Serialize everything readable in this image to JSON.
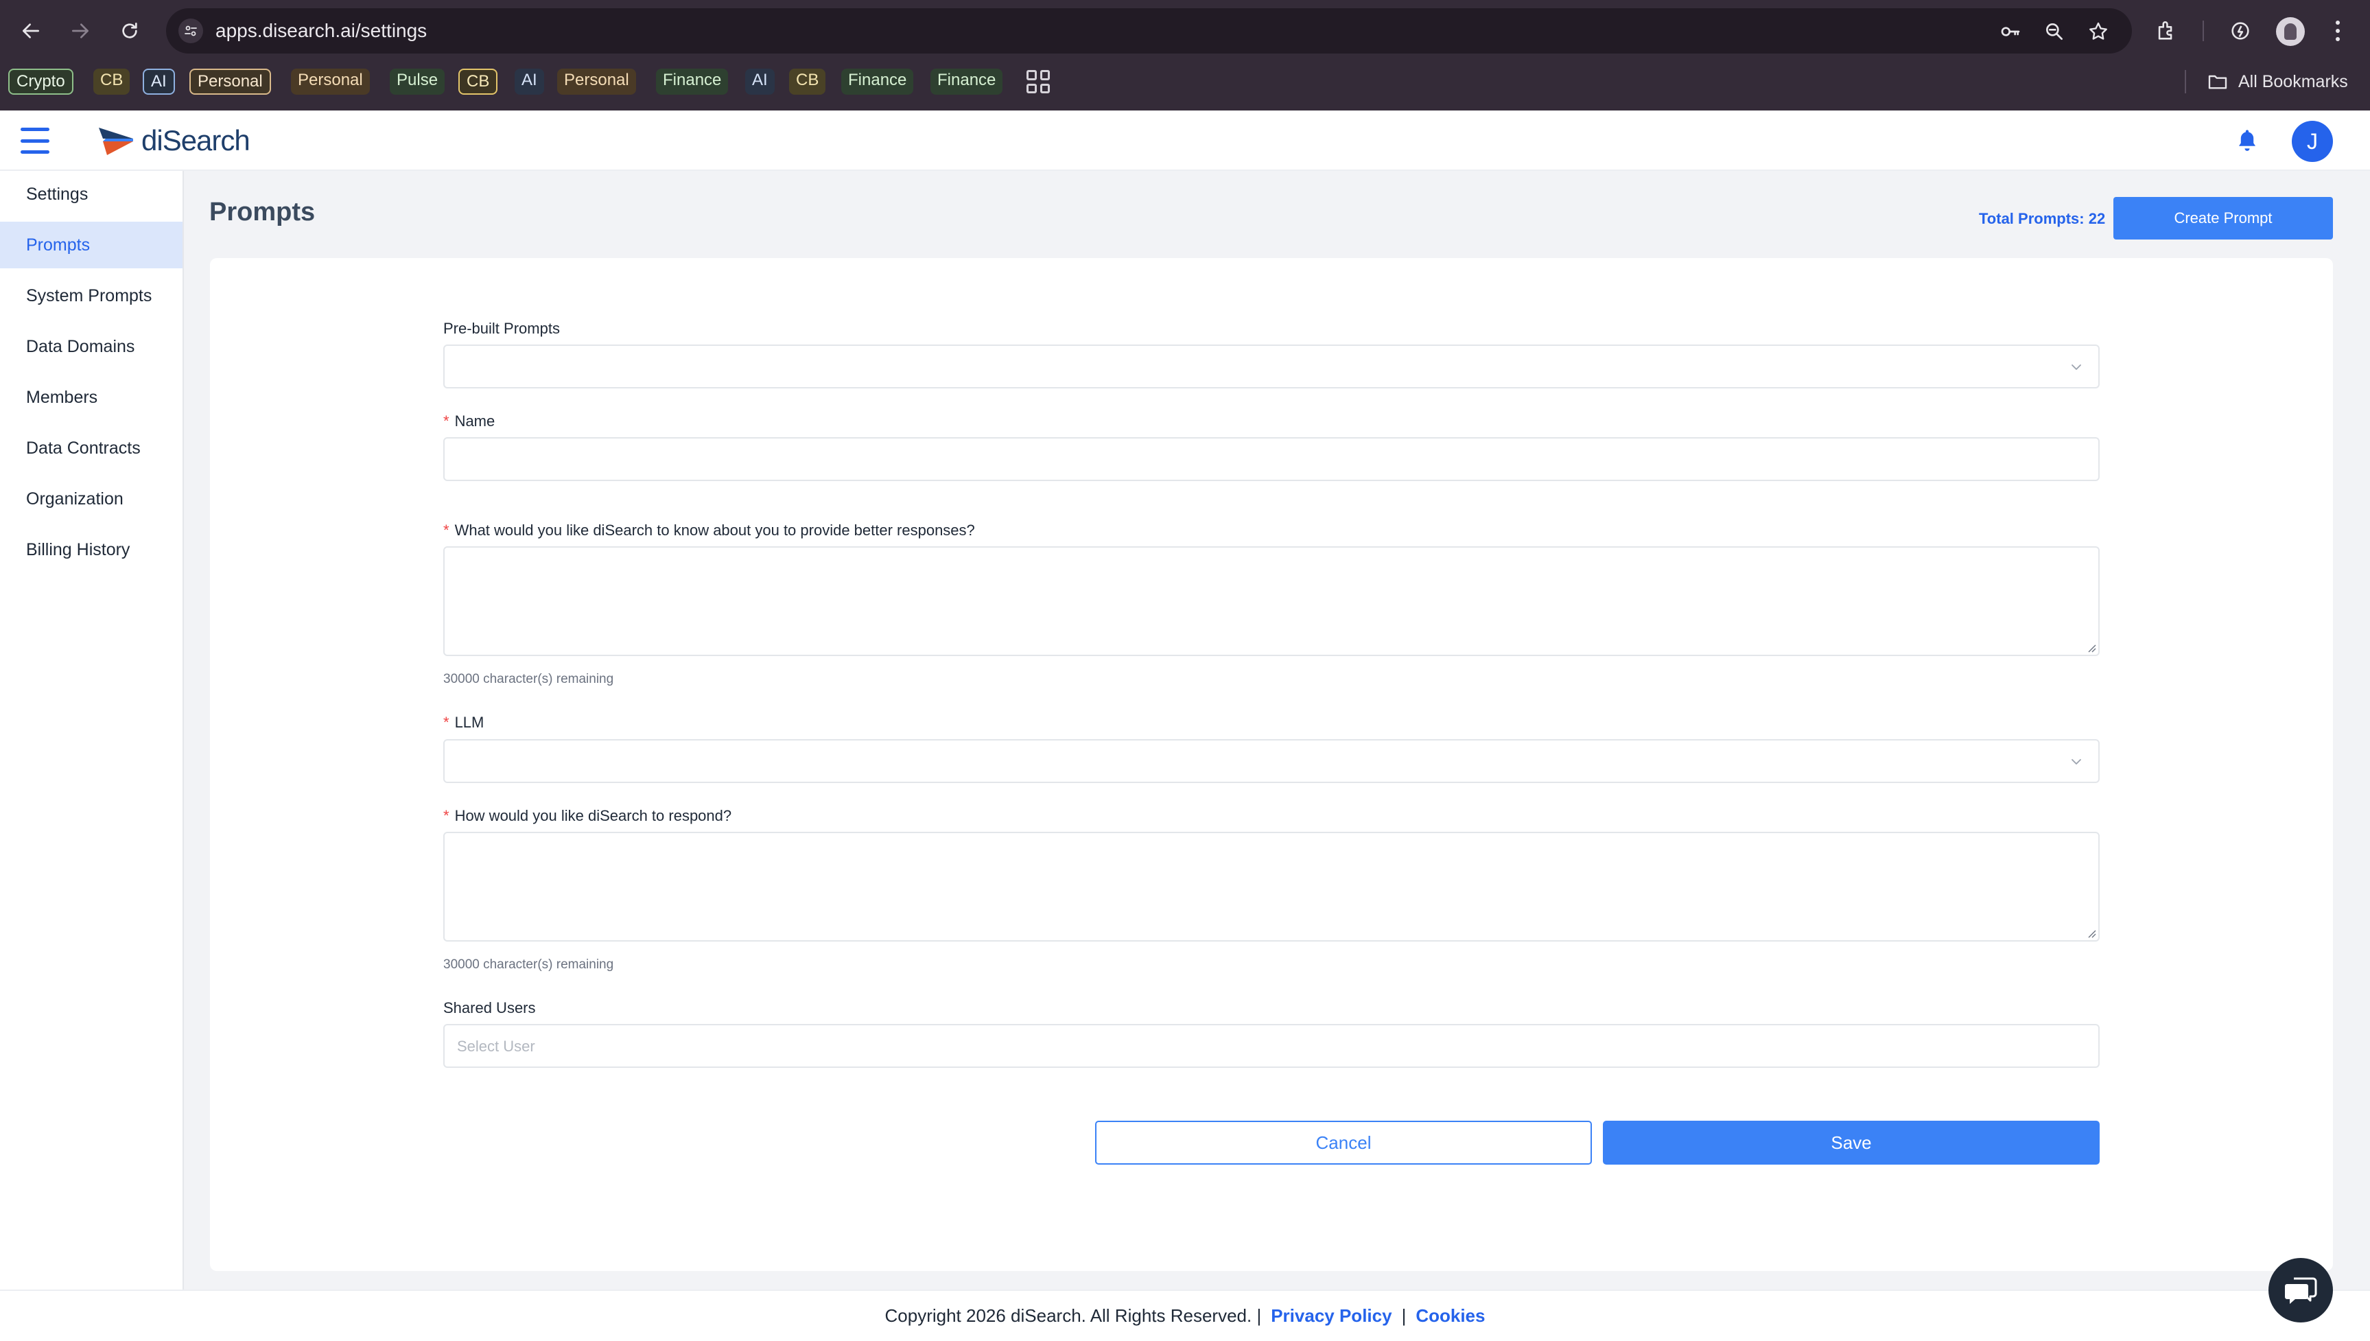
{
  "browser": {
    "url": "apps.disearch.ai/settings",
    "bookmarks": [
      {
        "label": "Crypto",
        "style": "framed-green"
      },
      {
        "label": "CB",
        "style": "fill-yellow"
      },
      {
        "label": "AI",
        "style": "framed-blue"
      },
      {
        "label": "Personal",
        "style": "framed-orange"
      },
      {
        "label": "Personal",
        "style": "fill-orange"
      },
      {
        "label": "Pulse",
        "style": "fill-green"
      },
      {
        "label": "CB",
        "style": "framed-yellow"
      },
      {
        "label": "AI",
        "style": "fill-blue"
      },
      {
        "label": "Personal",
        "style": "fill-orange"
      },
      {
        "label": "Finance",
        "style": "fill-green"
      },
      {
        "label": "AI",
        "style": "fill-blue"
      },
      {
        "label": "CB",
        "style": "fill-yellow"
      },
      {
        "label": "Finance",
        "style": "fill-green"
      },
      {
        "label": "Finance",
        "style": "fill-green"
      }
    ],
    "all_bookmarks": "All Bookmarks"
  },
  "app": {
    "brand": "diSearch",
    "avatar_initial": "J",
    "accent_color": "#3b82f6"
  },
  "sidebar": {
    "items": [
      {
        "label": "Settings",
        "active": false
      },
      {
        "label": "Prompts",
        "active": true
      },
      {
        "label": "System Prompts",
        "active": false
      },
      {
        "label": "Data Domains",
        "active": false
      },
      {
        "label": "Members",
        "active": false
      },
      {
        "label": "Data Contracts",
        "active": false
      },
      {
        "label": "Organization",
        "active": false
      },
      {
        "label": "Billing History",
        "active": false
      }
    ]
  },
  "main": {
    "title": "Prompts",
    "total_prompts": "Total Prompts: 22",
    "create_button": "Create Prompt"
  },
  "form": {
    "prebuilt": {
      "label": "Pre-built Prompts",
      "value": ""
    },
    "name": {
      "label": "Name",
      "value": ""
    },
    "about": {
      "label": "What would you like diSearch to know about you to provide better responses?",
      "value": "",
      "hint": "30000 character(s) remaining"
    },
    "llm": {
      "label": "LLM",
      "value": ""
    },
    "respond": {
      "label": "How would you like diSearch to respond?",
      "value": "",
      "hint": "30000 character(s) remaining"
    },
    "shared_users": {
      "label": "Shared Users",
      "placeholder": "Select User"
    },
    "required_mark": "*",
    "cancel": "Cancel",
    "save": "Save"
  },
  "footer": {
    "copyright": "Copyright 2026 diSearch. All Rights Reserved. |",
    "privacy": "Privacy Policy",
    "separator": "|",
    "cookies": "Cookies"
  }
}
